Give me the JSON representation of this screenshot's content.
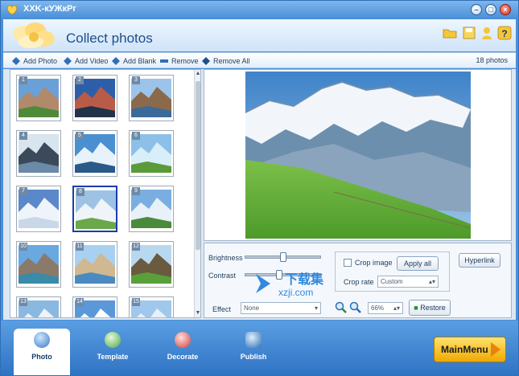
{
  "window": {
    "title": "XXK-кУЖкРг"
  },
  "header": {
    "title": "Collect photos"
  },
  "toolbar": {
    "add_photo": "Add Photo",
    "add_video": "Add Video",
    "add_blank": "Add Blank",
    "remove": "Remove",
    "remove_all": "Remove All",
    "photo_count": "18 photos"
  },
  "thumbnails": [
    {
      "num": "1"
    },
    {
      "num": "2"
    },
    {
      "num": "3"
    },
    {
      "num": "4"
    },
    {
      "num": "5"
    },
    {
      "num": "6"
    },
    {
      "num": "7"
    },
    {
      "num": "8"
    },
    {
      "num": "9"
    },
    {
      "num": "10"
    },
    {
      "num": "11"
    },
    {
      "num": "12"
    },
    {
      "num": "13"
    },
    {
      "num": "14"
    },
    {
      "num": "15"
    }
  ],
  "selected_thumbnail": 8,
  "controls": {
    "brightness_label": "Brightness",
    "brightness_value": 0.5,
    "contrast_label": "Contrast",
    "contrast_value": 0.45,
    "effect_label": "Effect",
    "effect_value": "None",
    "crop_image_label": "Crop image",
    "crop_checked": false,
    "apply_all_label": "Apply all",
    "crop_rate_label": "Crop rate",
    "crop_rate_value": "Custom",
    "hyperlink_label": "Hyperlink",
    "zoom_value": "66%",
    "restore_label": "Restore"
  },
  "watermark": {
    "brand": "下载集",
    "site": "xzji.com"
  },
  "tabs": [
    {
      "label": "Photo",
      "active": true
    },
    {
      "label": "Template",
      "active": false
    },
    {
      "label": "Decorate",
      "active": false
    },
    {
      "label": "Publish",
      "active": false
    }
  ],
  "main_menu_label": "MainMenu",
  "colors": {
    "accent": "#4a8fd8",
    "selected_border": "#1a3da8",
    "main_menu": "#f0a800"
  }
}
